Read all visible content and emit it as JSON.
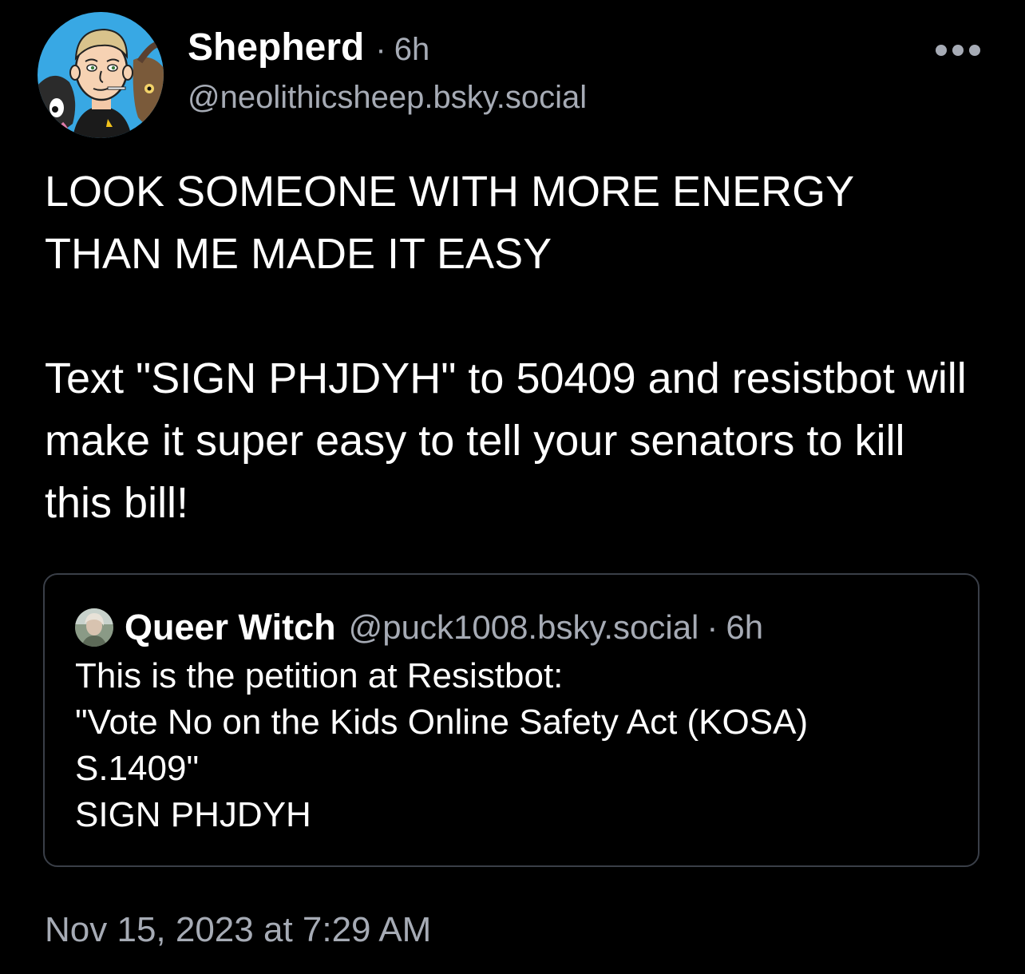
{
  "colors": {
    "background": "#000000",
    "text_primary": "#ffffff",
    "text_secondary": "#a6abb5",
    "card_border": "#3a3f48"
  },
  "post": {
    "author": {
      "display_name": "Shepherd",
      "handle": "@neolithicsheep.bsky.social",
      "avatar_icon": "cartoon-avatar-with-goats"
    },
    "separator": "·",
    "age": "6h",
    "more_icon": "ellipsis-horizontal-icon",
    "body": {
      "paragraph_1": "LOOK SOMEONE WITH MORE ENERGY THAN ME MADE IT EASY",
      "paragraph_2": "Text \"SIGN PHJDYH\" to 50409 and resistbot will make it super easy to tell your senators to kill this bill!"
    },
    "timestamp": "Nov 15, 2023 at 7:29 AM"
  },
  "quote": {
    "author": {
      "display_name": "Queer Witch",
      "handle": "@puck1008.bsky.social",
      "avatar_icon": "photo-avatar"
    },
    "separator": "·",
    "age": "6h",
    "lines": [
      "This is the petition at Resistbot:",
      "\"Vote No on the Kids Online Safety Act (KOSA)",
      "S.1409\"",
      "SIGN PHJDYH"
    ]
  }
}
